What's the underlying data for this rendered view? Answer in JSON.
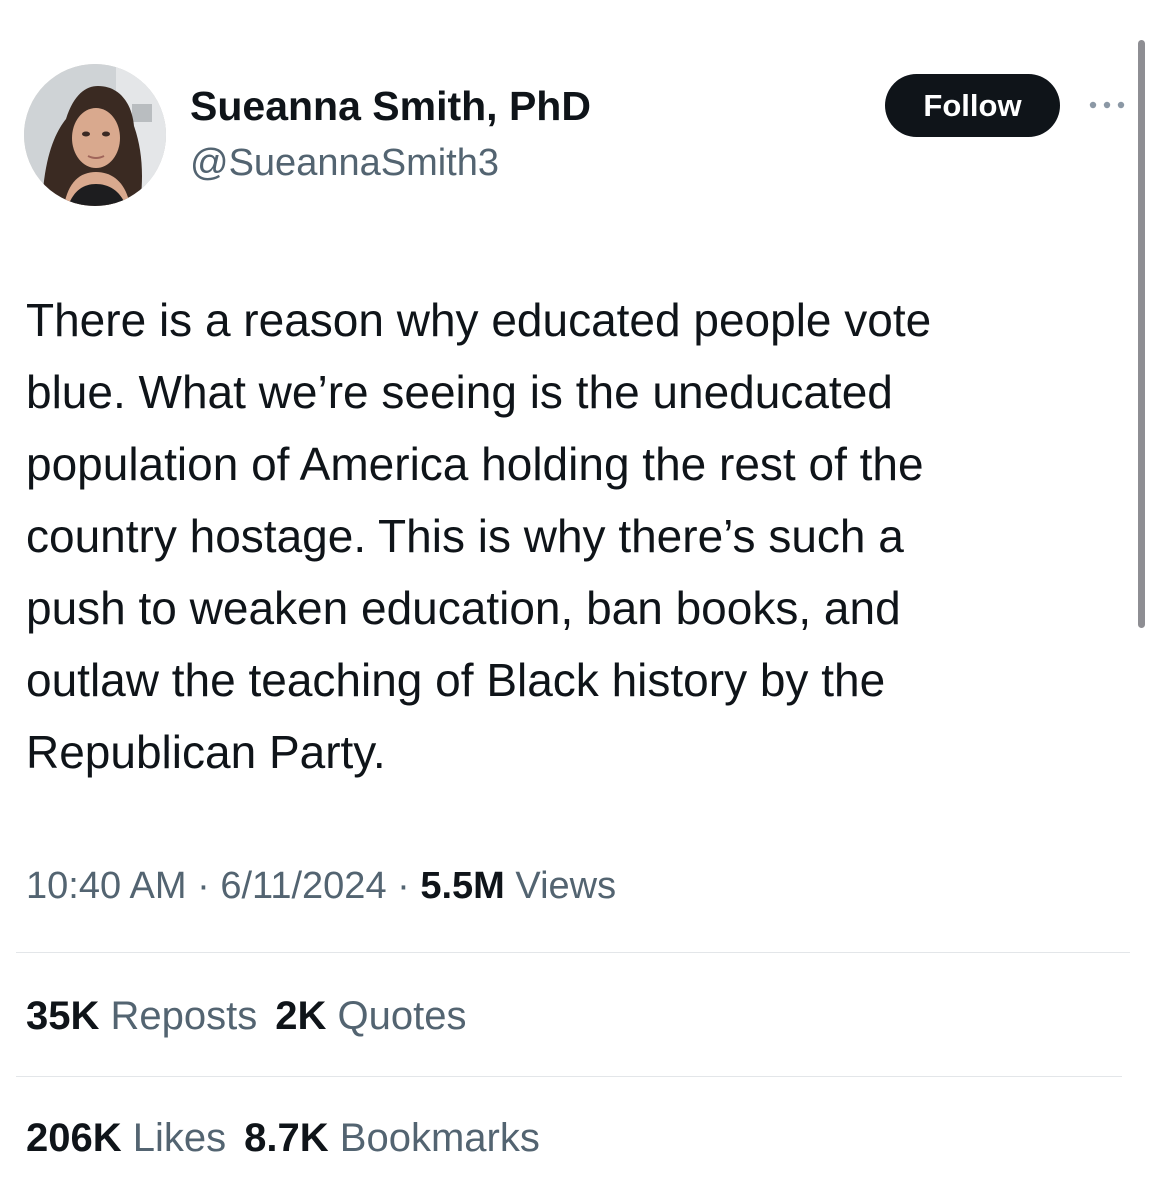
{
  "author": {
    "display_name": "Sueanna Smith, PhD",
    "handle": "@SueannaSmith3",
    "avatar_icon": "profile-photo"
  },
  "header": {
    "follow_label": "Follow",
    "more_icon": "ellipsis-icon"
  },
  "tweet": {
    "lines": [
      "There is a reason why educated people vote",
      "blue. What we’re seeing is the uneducated",
      "population of America holding the rest of the",
      "country hostage. This is why there’s such a",
      "push to weaken education, ban books, and",
      "outlaw the teaching of Black history by the",
      "Republican Party."
    ]
  },
  "meta": {
    "time": "10:40 AM",
    "separator": " · ",
    "date": "6/11/2024",
    "views_count": "5.5M",
    "views_label": "Views"
  },
  "stats": {
    "reposts": {
      "count": "35K",
      "label": "Reposts"
    },
    "quotes": {
      "count": "2K",
      "label": "Quotes"
    },
    "likes": {
      "count": "206K",
      "label": "Likes"
    },
    "bookmarks": {
      "count": "8.7K",
      "label": "Bookmarks"
    }
  },
  "colors": {
    "text_primary": "#0f1419",
    "text_secondary": "#536471",
    "divider": "#e3e6e9",
    "button_bg": "#0f1419"
  }
}
